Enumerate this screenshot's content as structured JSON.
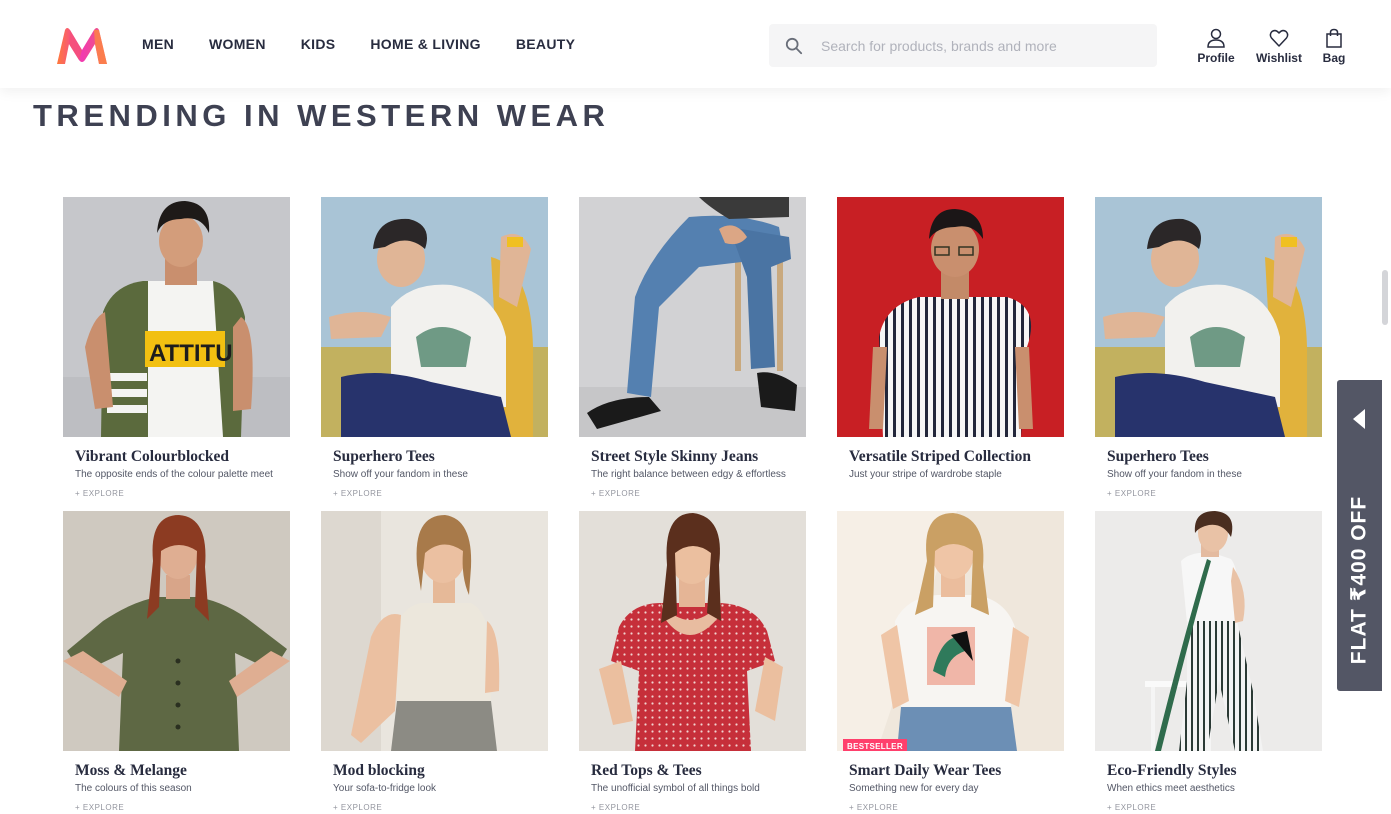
{
  "header": {
    "nav": [
      "MEN",
      "WOMEN",
      "KIDS",
      "HOME & LIVING",
      "BEAUTY"
    ],
    "search_placeholder": "Search for products, brands and more",
    "actions": {
      "profile": "Profile",
      "wishlist": "Wishlist",
      "bag": "Bag"
    }
  },
  "section_title": "TRENDING IN WESTERN WEAR",
  "cards": [
    {
      "name": "Vibrant Colourblocked",
      "desc": "The opposite ends of the colour palette meet",
      "explore": "+ EXPLORE",
      "graphic_text": "ATTITU"
    },
    {
      "name": "Superhero Tees",
      "desc": "Show off your fandom in these",
      "explore": "+ EXPLORE"
    },
    {
      "name": "Street Style Skinny Jeans",
      "desc": "The right balance between edgy & effortless",
      "explore": "+ EXPLORE"
    },
    {
      "name": "Versatile Striped Collection",
      "desc": "Just your stripe of wardrobe staple",
      "explore": ""
    },
    {
      "name": "Superhero Tees",
      "desc": "Show off your fandom in these",
      "explore": "+ EXPLORE"
    },
    {
      "name": "Moss & Melange",
      "desc": "The colours of this season",
      "explore": "+ EXPLORE"
    },
    {
      "name": "Mod blocking",
      "desc": "Your sofa-to-fridge look",
      "explore": "+ EXPLORE"
    },
    {
      "name": "Red Tops & Tees",
      "desc": "The unofficial symbol of all things bold",
      "explore": "+ EXPLORE"
    },
    {
      "name": "Smart Daily Wear Tees",
      "desc": "Something new for every day",
      "explore": "+ EXPLORE",
      "badge": "BESTSELLER"
    },
    {
      "name": "Eco-Friendly Styles",
      "desc": "When ethics meet aesthetics",
      "explore": "+ EXPLORE"
    }
  ],
  "offer_tab": {
    "text": "FLAT ₹400 OFF"
  },
  "colors": {
    "accent": "#ff3f6c",
    "text": "#282c3f",
    "offer_bg": "#535665"
  },
  "icons": [
    "myntra-logo",
    "search-icon",
    "profile-icon",
    "wishlist-heart-icon",
    "bag-icon",
    "arrow-left-icon"
  ]
}
